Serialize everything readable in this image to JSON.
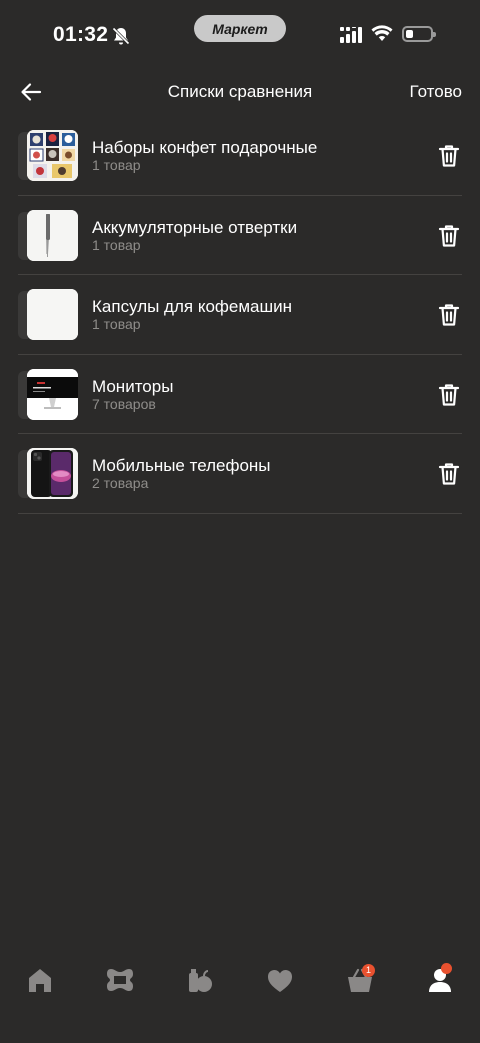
{
  "status_bar": {
    "time": "01:32",
    "center_label": "Маркет"
  },
  "header": {
    "title": "Списки сравнения",
    "done_label": "Готово"
  },
  "lists": [
    {
      "name": "Наборы конфет подарочные",
      "count": "1 товар",
      "thumbnail": "candy-boxes"
    },
    {
      "name": "Аккумуляторные отвертки",
      "count": "1 товар",
      "thumbnail": "screwdriver"
    },
    {
      "name": "Капсулы для кофемашин",
      "count": "1 товар",
      "thumbnail": "coffee-capsules"
    },
    {
      "name": "Мониторы",
      "count": "7 товаров",
      "thumbnail": "monitor"
    },
    {
      "name": "Мобильные телефоны",
      "count": "2 товара",
      "thumbnail": "phone"
    }
  ],
  "bottom_nav": {
    "items": [
      "home-icon",
      "catalog-icon",
      "grocery-icon",
      "favorites-icon",
      "cart-icon",
      "profile-icon"
    ],
    "cart_badge": "1"
  },
  "colors": {
    "background": "#2b2a29",
    "divider": "#444240",
    "badge": "#e8512f",
    "secondary_text": "#8f8d8a"
  }
}
